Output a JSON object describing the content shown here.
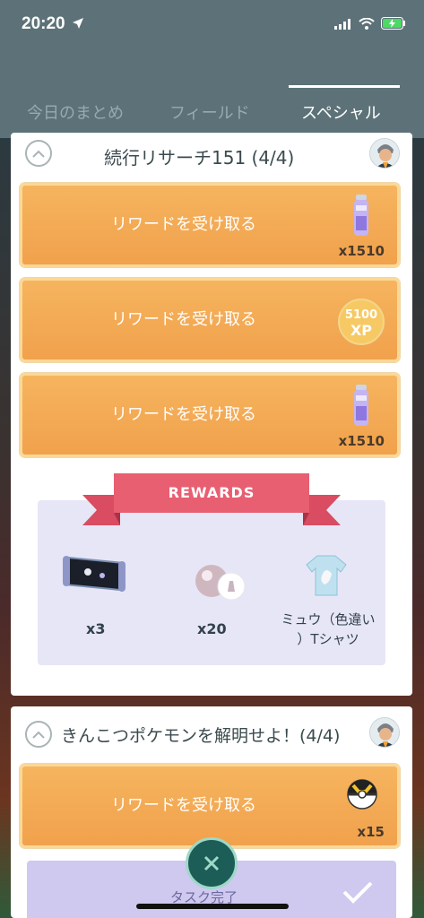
{
  "status_bar": {
    "time": "20:20"
  },
  "tabs": [
    {
      "label": "今日のまとめ"
    },
    {
      "label": "フィールド"
    },
    {
      "label": "スペシャル"
    }
  ],
  "card1": {
    "title": "続行リサーチ151 (4/4)",
    "rewards": [
      {
        "label": "リワードを受け取る",
        "qty": "x1510",
        "icon": "potion-icon"
      },
      {
        "label": "リワードを受け取る",
        "xp_value": "5100",
        "xp_label": "XP",
        "icon": "xp-icon"
      },
      {
        "label": "リワードを受け取る",
        "qty": "x1510",
        "icon": "potion-icon"
      }
    ],
    "rewards_banner": "REWARDS",
    "reward_items": [
      {
        "qty": "x3",
        "icon": "star-piece-map-icon"
      },
      {
        "qty": "x20",
        "icon": "pokeball-icon"
      },
      {
        "label_line1": "ミュウ（色違い",
        "label_line2": "）Tシャツ",
        "icon": "tshirt-icon"
      }
    ]
  },
  "card2": {
    "title": "きんこつポケモンを解明せよ！(4/4)",
    "reward": {
      "label": "リワードを受け取る",
      "qty": "x15",
      "icon": "ultraball-icon"
    },
    "task_done_label": "タスク完了"
  },
  "colors": {
    "accent_orange": "#f1a14c",
    "ribbon_pink": "#e85f72",
    "header_teal": "#5d7278"
  }
}
